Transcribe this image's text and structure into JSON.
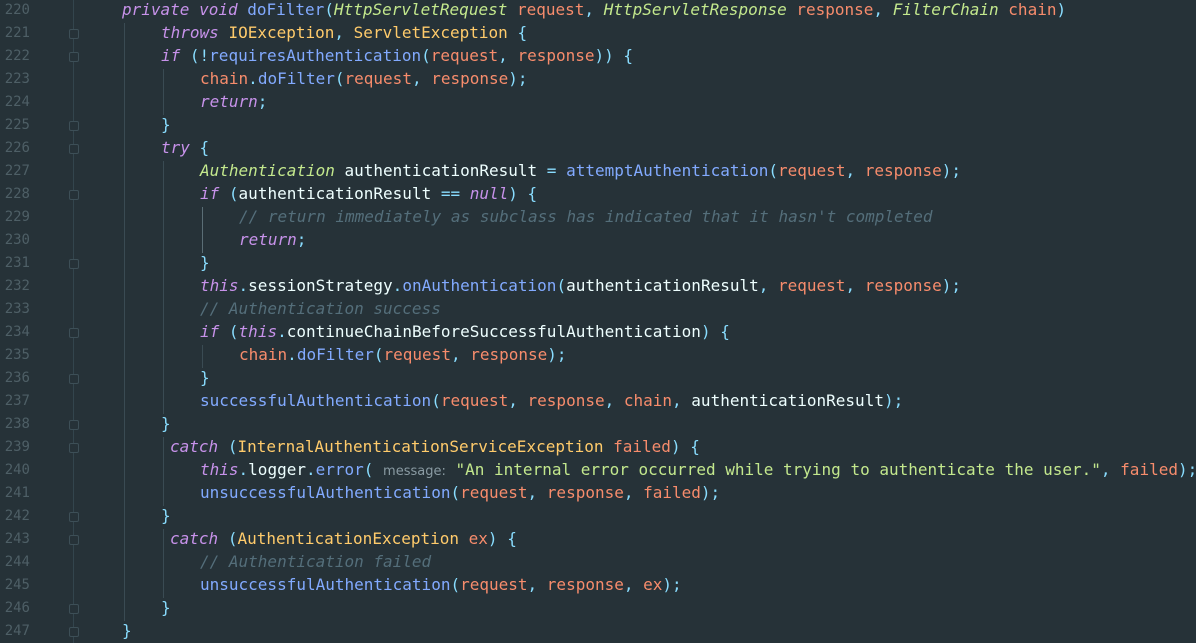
{
  "line_numbers": [
    "220",
    "221",
    "222",
    "223",
    "224",
    "225",
    "226",
    "227",
    "228",
    "229",
    "230",
    "231",
    "232",
    "233",
    "234",
    "235",
    "236",
    "237",
    "238",
    "239",
    "240",
    "241",
    "242",
    "243",
    "244",
    "245",
    "246",
    "247"
  ],
  "tokens": {
    "private": "private",
    "void": "void",
    "doFilter": "doFilter",
    "HttpServletRequest": "HttpServletRequest",
    "HttpServletResponse": "HttpServletResponse",
    "FilterChain": "FilterChain",
    "request": "request",
    "response": "response",
    "chain": "chain",
    "throws": "throws",
    "IOException": "IOException",
    "ServletException": "ServletException",
    "if": "if",
    "requiresAuthentication": "requiresAuthentication",
    "return": "return",
    "try": "try",
    "Authentication": "Authentication",
    "authenticationResult": "authenticationResult",
    "attemptAuthentication": "attemptAuthentication",
    "null": "null",
    "comment_229": "// return immediately as subclass has indicated that it hasn't completed",
    "this": "this",
    "sessionStrategy": "sessionStrategy",
    "onAuthentication": "onAuthentication",
    "comment_233": "// Authentication success",
    "continueChainBeforeSuccessfulAuthentication": "continueChainBeforeSuccessfulAuthentication",
    "successfulAuthentication": "successfulAuthentication",
    "catch": "catch",
    "InternalAuthenticationServiceException": "InternalAuthenticationServiceException",
    "failed": "failed",
    "logger": "logger",
    "error": "error",
    "message_hint": "message:",
    "error_string": "\"An internal error occurred while trying to authenticate the user.\"",
    "unsuccessfulAuthentication": "unsuccessfulAuthentication",
    "AuthenticationException": "AuthenticationException",
    "ex": "ex",
    "comment_244": "// Authentication failed"
  },
  "colors": {
    "background": "#263238",
    "keyword": "#c792ea",
    "function": "#82aaff",
    "type": "#ffcb6b",
    "parameter": "#f78c6c",
    "string": "#c3e88d",
    "comment": "#546e7a",
    "punctuation": "#89ddff",
    "line_number": "#4e5f66"
  }
}
